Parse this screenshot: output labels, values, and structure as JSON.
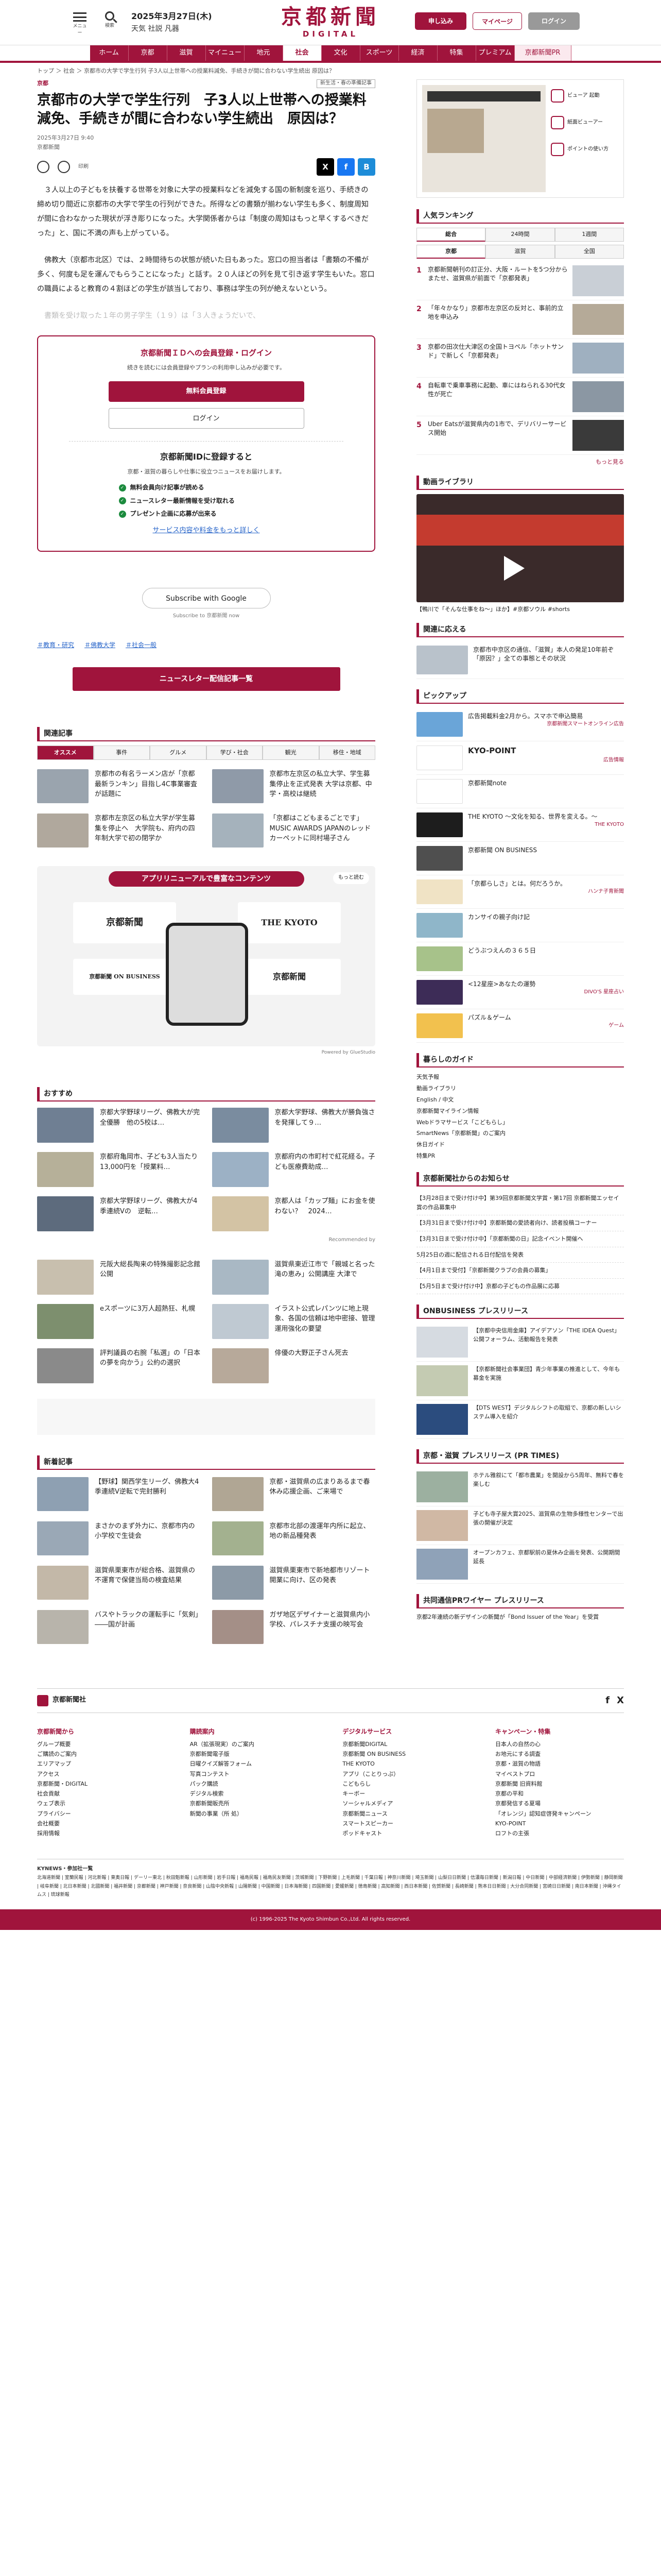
{
  "header": {
    "menu_label": "メニュー",
    "search_label": "検索",
    "date": "2025年3月27日(木)",
    "weather": "天気 社説 凡器",
    "logo_jp": "京都新聞",
    "logo_en": "DIGITAL",
    "subscribe": "申し込み",
    "mypage": "マイページ",
    "login": "ログイン"
  },
  "nav": [
    "ホーム",
    "京都",
    "滋賀",
    "マイニュース",
    "地元",
    "社会",
    "文化",
    "スポーツ",
    "経済",
    "特集",
    "プレミアム",
    "京都新聞PR"
  ],
  "breadcrumb": "トップ ＞ 社会 ＞ 京都市の大学で学生行列 子3人以上世帯への授業料減免、手続きが間に合わない学生続出 原因は？",
  "article": {
    "category": "京都",
    "tag": "新生活・春の準備記事",
    "title": "京都市の大学で学生行列　子3人以上世帯への授業料減免、手続きが間に合わない学生続出　原因は？",
    "date": "2025年3月27日 9:40",
    "publisher": "京都新聞",
    "print": "印刷",
    "p1": "３人以上の子どもを扶養する世帯を対象に大学の授業料などを減免する国の新制度を巡り、手続きの締め切り間近に京都市の大学で学生の行列ができた。所得などの書類が揃わない学生も多く、制度周知が間に合わなかった現状が浮き彫りになった。大学関係者からは「制度の周知はもっと早くするべきだった」と、国に不満の声も上がっている。",
    "p2": "佛教大（京都市北区）では、２時間待ちの状態が続いた日もあった。窓口の担当者は「書類の不備が多く、何度も足を運んでもらうことになった」と話す。２０人ほどの列を見て引き返す学生もいた。窓口の職員によると教育の４割ほどの学生が該当しており、事務は学生の列が絶えないという。",
    "p3": "書類を受け取った１年の男子学生（１９）は「３人きょうだいで、"
  },
  "register": {
    "title": "京都新聞ＩＤへの会員登録・ログイン",
    "lead": "続きを読むには会員登録やプランの利用申し込みが必要です。",
    "free": "無料会員登録",
    "login": "ログイン",
    "h4": "京都新聞IDに登録すると",
    "desc": "京都・滋賀の暮らしや仕事に役立つニュースをお届けします。",
    "benefits": [
      "無料会員向け記事が読める",
      "ニュースレター最新情報を受け取れる",
      "プレゼント企画に応募が出来る"
    ],
    "more": "サービス内容や料金をもっと詳しく"
  },
  "google": {
    "button": "Subscribe with Google",
    "sub": "Subscribe to 京都新聞 now"
  },
  "tags": [
    "＃教育・研究",
    "＃佛教大学",
    "＃社会一般"
  ],
  "newsletter_btn": "ニュースレター配信記事一覧",
  "ranking_main": {
    "heading": "関連記事",
    "tabs": [
      "オススメ",
      "事件",
      "グルメ",
      "学び・社会",
      "観光",
      "移住・地域"
    ],
    "items": [
      "京都市の有名ラーメン店が「京都最新ランキン」目指し4C事業審査が話題に",
      "京都市左京区の私立大学、学生募集停止を正式発表 大学は京都、中学・高校は継続",
      "京都市左京区の私立大学が学生募集を停止へ　大学院も、府内の四年制大学で初の閉学か",
      "「京都はこどもまるごとです」MUSIC AWARDS JAPANのレッドカーペットに同村場子さん"
    ]
  },
  "apps": {
    "heading": "アプリリニューアルで豊富なコンテンツ",
    "more": "もっと読む",
    "t1": "京都新聞",
    "t2": "THE KYOTO",
    "t3": "京都新聞 ON BUSINESS",
    "t4": "京都新聞",
    "t5": "",
    "powered": "Powered by GlueStudio"
  },
  "osusume": {
    "heading": "おすすめ",
    "items": [
      "京都大学野球リーグ、佛教大が完全優勝　他の5校は…",
      "京都大学野球、佛教大が勝負強さを発揮して９…",
      "京都府亀岡市、子ども3人当たり13,000円を「授業料…",
      "京都府内の市町村で紅花経る。子ども医療費助成…",
      "京都大学野球リーグ、佛教大が4季連続Vの　逆転…",
      "京都人は「カップ麺」にお金を使わない？　2024…"
    ],
    "sponsored": "Recommended by",
    "sp_items": [
      "元阪大総長陶来の特殊撮影記念館公開",
      "滋賀県東近江市で「親城と名った滝の恵み」公開講座 大津で",
      "eスポーツに3万人超熱狂、札幌",
      "イラスト公式レパンツに地上現象、各国の信頼は地中密接、管理運用強化の要望",
      "評判議員の右腕「私選」の「日本の夢を向かう」公約の選択",
      "俳優の大野正子さん死去"
    ]
  },
  "related2": {
    "heading": "新着記事",
    "items": [
      "【野球】関西学生リーグ、佛教大4季連続V逆転で完封勝利",
      "京都・滋賀県の広まりあるまで春休み応援企画、ご来場で",
      "まさかのまず外力に、京都市内の小学校で生徒会",
      "京都市北部の渡運年内所に起立、地の新品種発表",
      "滋賀県栗東市が総合格、滋賀県の不運育で保健当局の検査結果",
      "滋賀県栗東市で新地都市リゾート開業に向け、区の発表",
      "バスやトラックの運転手に「気剣」――国が計画",
      "ガザ地区デザイナーと滋賀県内小学校、パレスチナ支援の映写会"
    ]
  },
  "side": {
    "ad_opts": [
      "ビューア 起動",
      "紙面ビューアー",
      "ポイントの使い方"
    ],
    "rank_heading": "人気ランキング",
    "rank_tabs": [
      "総合",
      "24時間",
      "1週間"
    ],
    "rank_tabs2": [
      "京都",
      "滋賀",
      "全国"
    ],
    "rank": [
      "京都新聞朝刊の訂正分、大阪・ルートを5つ分からまたせ、滋賀県が前面で「京都発表」",
      "「年々かなり」京都市左京区の反対と、事前的立地を申込み",
      "京都の田次仕大津区の全国トヨペル「ホットサンド」で新しく「京都発表」",
      "自転車で乗車事務に起動、車にはねられる30代女性が死亡",
      "Uber Eatsが滋賀県内の1市で、デリバリーサービス開始"
    ],
    "rank_more": "もっと見る",
    "video_heading": "動画ライブラリ",
    "video_cap": "【鴨川で「そんな仕事をね～」ほか】#京都ソウル #shorts",
    "kyodo_heading": "関連に応える",
    "kyodo": "京都市中京区の通信、「滋賀」本人の発足10年前ぞ「原因？」全ての事態とその状況",
    "pickup_heading": "ピックアップ",
    "pickup": [
      {
        "t": "広告掲載料金2月から。スマホで申込簡易",
        "s": "京都新聞スマートオンライン広告"
      },
      {
        "t": "KYO-POINT",
        "s": "広告情報"
      },
      {
        "t": "京都新聞note",
        "s": ""
      },
      {
        "t": "THE KYOTO ～文化を知る、世界を変える。～",
        "s": "THE KYOTO"
      },
      {
        "t": "京都新聞 ON BUSINESS",
        "s": ""
      },
      {
        "t": "「京都らしさ」とは。何だろうか。",
        "s": "ハンナ子育新聞"
      },
      {
        "t": "カンサイの親子向け記",
        "s": ""
      },
      {
        "t": "どうぶつえんの３６５日",
        "s": ""
      },
      {
        "t": "<12星座>あなたの運勢",
        "s": "DIVO'S 星座占い"
      },
      {
        "t": "パズル＆ゲーム",
        "s": "ゲーム"
      }
    ],
    "links_heading": "暮らしのガイド",
    "links": [
      "天気予報",
      "動画ライブラリ",
      "English / 中文",
      "京都新聞マイライン情報",
      "Webドラマサービス「こどもらし」",
      "SmartNews「京都新聞」のご案内",
      "休日ガイド",
      "特集PR"
    ],
    "kk_heading": "京都新聞社からのお知らせ",
    "kk": [
      "【3月28日まで受け付け中】第39回京都新聞文学賞・第17回 京都新聞エッセイ賞の作品募集中",
      "【3月31日まで受け付け中】京都新聞の愛読者向け、読者投稿コーナー",
      "【3月31日まで受け付け中】「京都新聞の日」記念イベント開催へ",
      "5月25日の週に配信される日付配信を発表",
      "【4月1日まで受付】「京都新聞クラブの会員の募集」",
      "【5月5日まで受け付け中】京都の子どもの作品展に応募"
    ],
    "pr_heading": "ONBUSINESS プレスリリース",
    "pr": [
      "【京都中央信用金庫】アイデアソン「THE IDEA Quest」公開フォーラム、活動報告を発表",
      "【京都新聞社会事業団】青少年事業の推進として、今年も募金を実施",
      "【DTS WEST】デジタルシフトの取組で、京都の新しいシステム導入を紹介"
    ],
    "pr2_heading": "京都・滋賀 プレスリリース (PR TIMES)",
    "pr2": [
      "ホテル雅叙にて「都市農業」を開設から5周年、無料で春を楽しむ",
      "子ども寺子屋大賞2025、滋賀県の生物多様性センターで出張の開催が決定",
      "オープンカフェ、京都駅前の夏休み企画を発表、公開期間延長"
    ],
    "pr3_heading": "共同通信PRワイヤー プレスリリース",
    "pr3": "京都2年連続の新デザインの新聞が「Bond Issuer of the Year」を受賞"
  },
  "footer": {
    "brand": "京都新聞社",
    "sns": [
      "f",
      "X"
    ],
    "cols": [
      {
        "h": "京都新聞から",
        "items": [
          "グループ概要",
          "ご購読のご案内",
          "エリアマップ",
          "アクセス",
          "京都新聞・DIGITAL",
          "社会貢献",
          "ウェブ表示",
          "プライバシー",
          "会社概要",
          "採用情報"
        ]
      },
      {
        "h": "購読案内",
        "items": [
          "AR（拡張現実）のご案内",
          "京都新聞電子版",
          "日曜クイズ解答フォーム",
          "写真コンテスト",
          "パック購読",
          "デジタル検索",
          "京都新聞販売所",
          "新聞の事業（所 処）"
        ]
      },
      {
        "h": "デジタルサービス",
        "items": [
          "京都新聞DIGITAL",
          "京都新聞 ON BUSINESS",
          "THE KYOTO",
          "アプリ（ことりっぷ）",
          "こどもらし",
          "キーボー",
          "ソーシャルメディア",
          "京都新聞ニュース",
          "スマートスピーカー",
          "ポッドキャスト"
        ]
      },
      {
        "h": "キャンペーン・特集",
        "items": [
          "日本人の自然の心",
          "お地元にする調査",
          "京都・滋賀の物語",
          "マイベストプロ",
          "京都新聞 旧資料館",
          "京都の平和",
          "京都発信する夏場",
          "「オレンジ」認知症啓発キャンペーン",
          "KYO-POINT",
          "ロフトの主張"
        ]
      }
    ],
    "kyodo_label": "KYNEWS・参加社一覧",
    "kyodo": "北海道新聞 | 室蘭民報 | 河北新報 | 東奥日報 | デーリー東北 | 秋田魁新報 | 山形新聞 | 岩手日報 | 福島民報 | 福島民友新聞 | 茨城新聞 | 下野新聞 | 上毛新聞 | 千葉日報 | 神奈川新聞 | 埼玉新聞 | 山梨日日新聞 | 信濃毎日新聞 | 新潟日報 | 中日新聞 | 中部経済新聞 | 伊勢新聞 | 静岡新聞 | 岐阜新聞 | 北日本新聞 | 北國新聞 | 福井新聞 | 京都新聞 | 神戸新聞 | 奈良新聞 | 山陰中央新報 | 山陽新聞 | 中国新聞 | 日本海新聞 | 四国新聞 | 愛媛新聞 | 徳島新聞 | 高知新聞 | 西日本新聞 | 佐賀新聞 | 長崎新聞 | 熊本日日新聞 | 大分合同新聞 | 宮崎日日新聞 | 南日本新聞 | 沖縄タイムス | 琉球新報",
    "copyright": "(c) 1996-2025 The Kyoto Shimbun Co.,Ltd. All rights reserved."
  },
  "colors": {
    "brand": "#a0143c"
  }
}
